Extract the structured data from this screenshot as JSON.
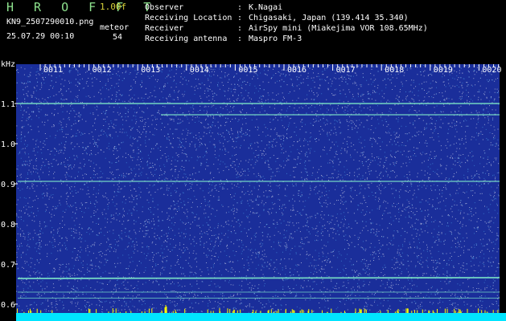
{
  "header": {
    "app_title": "H R O F F T",
    "version": "1.00f",
    "filename": "KN9_2507290010.png",
    "datetime": "25.07.29 00:10",
    "meteor_label": "meteor",
    "meteor_count": "54",
    "meta": [
      {
        "label": "Observer",
        "value": "K.Nagai"
      },
      {
        "label": "Receiving Location",
        "value": "Chigasaki, Japan (139.414 35.340)"
      },
      {
        "label": "Receiver",
        "value": "AirSpy mini (Miakejima VOR 108.65MHz)"
      },
      {
        "label": "Receiving antenna",
        "value": "Maspro FM-3"
      }
    ]
  },
  "spectrogram": {
    "unit_label": "kHz",
    "y_ticks": [
      "1.1",
      "1.0",
      "0.9",
      "0.8",
      "0.7",
      "0.6"
    ],
    "time_ticks": [
      "0011",
      "0012",
      "0013",
      "0014",
      "0015",
      "0016",
      "0017",
      "0018",
      "0019",
      "0020"
    ],
    "colors": {
      "background": "#1a2e9a",
      "noise": "#ffffff",
      "carrier": "#7de8c8",
      "baseline": "#00e5ff",
      "spike": "#ffff00"
    }
  }
}
